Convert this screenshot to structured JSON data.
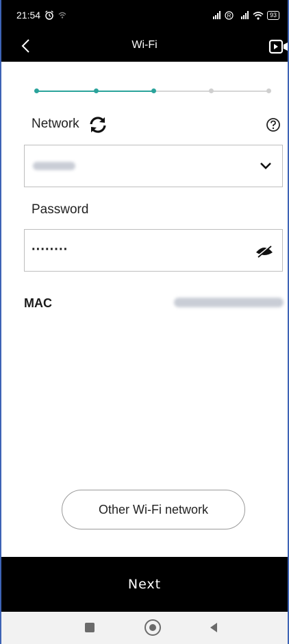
{
  "status_bar": {
    "time": "21:54",
    "battery": "93"
  },
  "nav": {
    "title": "Wi-Fi"
  },
  "stepper": {
    "total_steps": 5,
    "current_step": 3,
    "active_color": "#2aa39b",
    "inactive_color": "#cfcfcf"
  },
  "network": {
    "label": "Network"
  },
  "password": {
    "label": "Password",
    "value": "········"
  },
  "mac": {
    "label": "MAC"
  },
  "buttons": {
    "other_network": "Other Wi-Fi network",
    "next": "Next"
  },
  "icons": {
    "back": "chevron-left-icon",
    "video": "video-guide-icon",
    "refresh": "refresh-icon",
    "help": "question-circle-icon",
    "dropdown": "chevron-down-icon",
    "visibility": "eye-off-icon"
  }
}
